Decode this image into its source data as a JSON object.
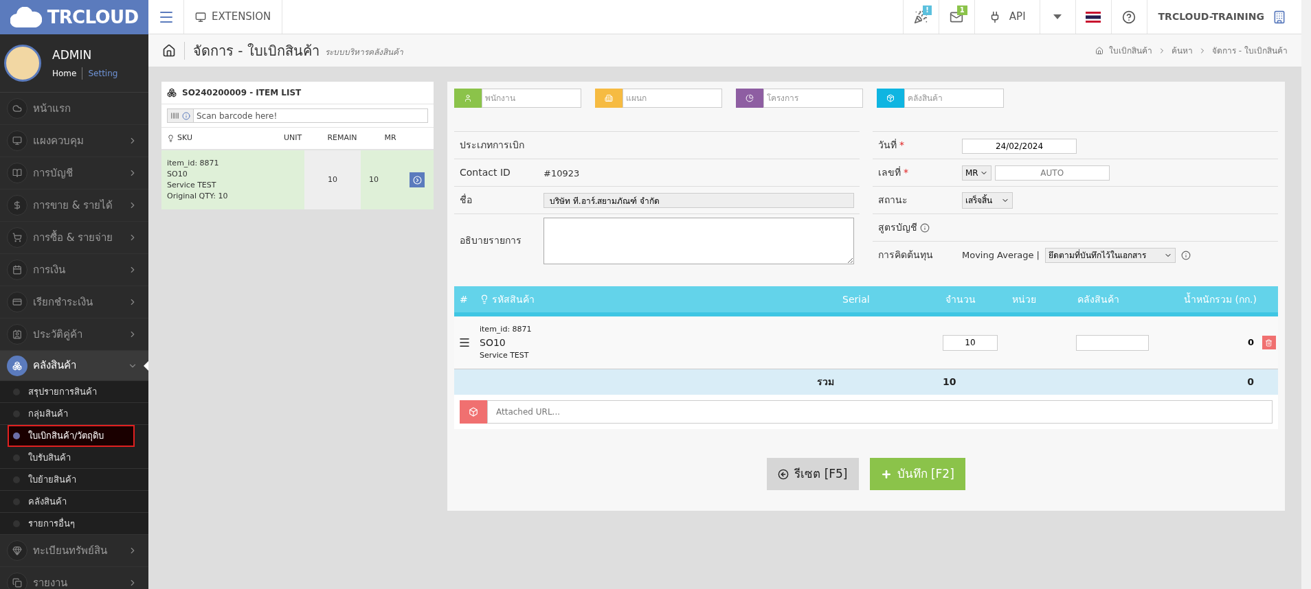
{
  "brand": {
    "name": "TRCLOUD"
  },
  "user": {
    "name": "ADMIN",
    "links": [
      "Home",
      "Setting"
    ]
  },
  "sidebar": {
    "items": [
      {
        "label": "หน้าแรก",
        "expandable": false,
        "expanded": false
      },
      {
        "label": "แผงควบคุม",
        "expandable": true,
        "expanded": false
      },
      {
        "label": "การบัญชี",
        "expandable": true,
        "expanded": false
      },
      {
        "label": "การขาย & รายได้",
        "expandable": true,
        "expanded": false
      },
      {
        "label": "การซื้อ & รายจ่าย",
        "expandable": true,
        "expanded": false
      },
      {
        "label": "การเงิน",
        "expandable": true,
        "expanded": false
      },
      {
        "label": "เรียกชำระเงิน",
        "expandable": true,
        "expanded": false
      },
      {
        "label": "ประวัติคู่ค้า",
        "expandable": true,
        "expanded": false
      },
      {
        "label": "คลังสินค้า",
        "expandable": true,
        "expanded": true,
        "children": [
          {
            "label": "สรุปรายการสินค้า",
            "selected": false
          },
          {
            "label": "กลุ่มสินค้า",
            "selected": false
          },
          {
            "label": "ใบเบิกสินค้า/วัตถุดิบ",
            "selected": true
          },
          {
            "label": "ใบรับสินค้า",
            "selected": false
          },
          {
            "label": "ใบย้ายสินค้า",
            "selected": false
          },
          {
            "label": "คลังสินค้า",
            "selected": false
          },
          {
            "label": "รายการอื่นๆ",
            "selected": false
          }
        ]
      },
      {
        "label": "ทะเบียนทรัพย์สิน",
        "expandable": true,
        "expanded": false
      },
      {
        "label": "รายงาน",
        "expandable": true,
        "expanded": false
      }
    ]
  },
  "topbar": {
    "extension": "EXTENSION",
    "notifications": [
      {
        "badge": "!",
        "color": "#5bc0de"
      },
      {
        "badge": "1",
        "color": "#8bc34a"
      }
    ],
    "api": "API",
    "company": "TRCLOUD-TRAINING"
  },
  "page": {
    "title": "จัดการ - ใบเบิกสินค้า",
    "subtitle": "ระบบบริหารคลังสินค้า",
    "breadcrumb": [
      "ใบเบิกสินค้า",
      "ค้นหา",
      "จัดการ - ใบเบิกสินค้า"
    ]
  },
  "item_list": {
    "title": "SO240200009 - ITEM LIST",
    "scan_placeholder": "Scan barcode here!",
    "columns": [
      "SKU",
      "UNIT",
      "REMAIN",
      "MR"
    ],
    "rows": [
      {
        "lines": [
          "item_id: 8871",
          "SO10",
          "Service TEST",
          "Original QTY: 10"
        ],
        "remain": "10",
        "mr": "10"
      }
    ]
  },
  "form": {
    "tags": [
      {
        "placeholder": "พนักงาน",
        "color": "#8bc34a"
      },
      {
        "placeholder": "แผนก",
        "color": "#f6bb42"
      },
      {
        "placeholder": "โครงการ",
        "color": "#8e5ea2"
      },
      {
        "placeholder": "คลังสินค้า",
        "color": "#0fb5e1"
      }
    ],
    "left_fields": [
      {
        "kind": "empty",
        "label": "ประเภทการเบิก"
      },
      {
        "kind": "text",
        "label": "Contact ID",
        "value": "#10923"
      },
      {
        "kind": "input",
        "label": "ชื่อ",
        "value": "บริษัท ที.อาร์.สยามภัณฑ์ จำกัด"
      },
      {
        "kind": "textarea",
        "label": "อธิบายรายการ"
      }
    ],
    "right_fields": [
      {
        "kind": "date",
        "label": "วันที่",
        "mark": "*",
        "value": "24/02/2024"
      },
      {
        "kind": "number",
        "label": "เลขที่",
        "mark": "*",
        "prefix": "MR",
        "placeholder": "AUTO"
      },
      {
        "kind": "select",
        "label": "สถานะ",
        "value": "เสร็จสิ้น"
      },
      {
        "kind": "info",
        "label": "สูตรบัญชี"
      },
      {
        "kind": "costing",
        "label": "การคิดต้นทุน",
        "text": "Moving Average |",
        "value": "ยึดตามที่บันทึกไว้ในเอกสาร"
      }
    ]
  },
  "lines_table": {
    "columns": [
      "#",
      "รหัสสินค้า",
      "Serial",
      "จำนวน",
      "หน่วย",
      "คลังสินค้า",
      "น้ำหนักรวม (กก.)"
    ],
    "rows": [
      {
        "item_id": "item_id: 8871",
        "sku": "SO10",
        "name": "Service TEST",
        "qty": "10",
        "weight": "0"
      }
    ],
    "total": {
      "label": "รวม",
      "qty": "10",
      "weight": "0"
    },
    "attach_placeholder": "Attached URL..."
  },
  "buttons": [
    {
      "kind": "reset",
      "label": "รีเซต [F5]"
    },
    {
      "kind": "save",
      "label": "บันทึก [F2]"
    }
  ]
}
